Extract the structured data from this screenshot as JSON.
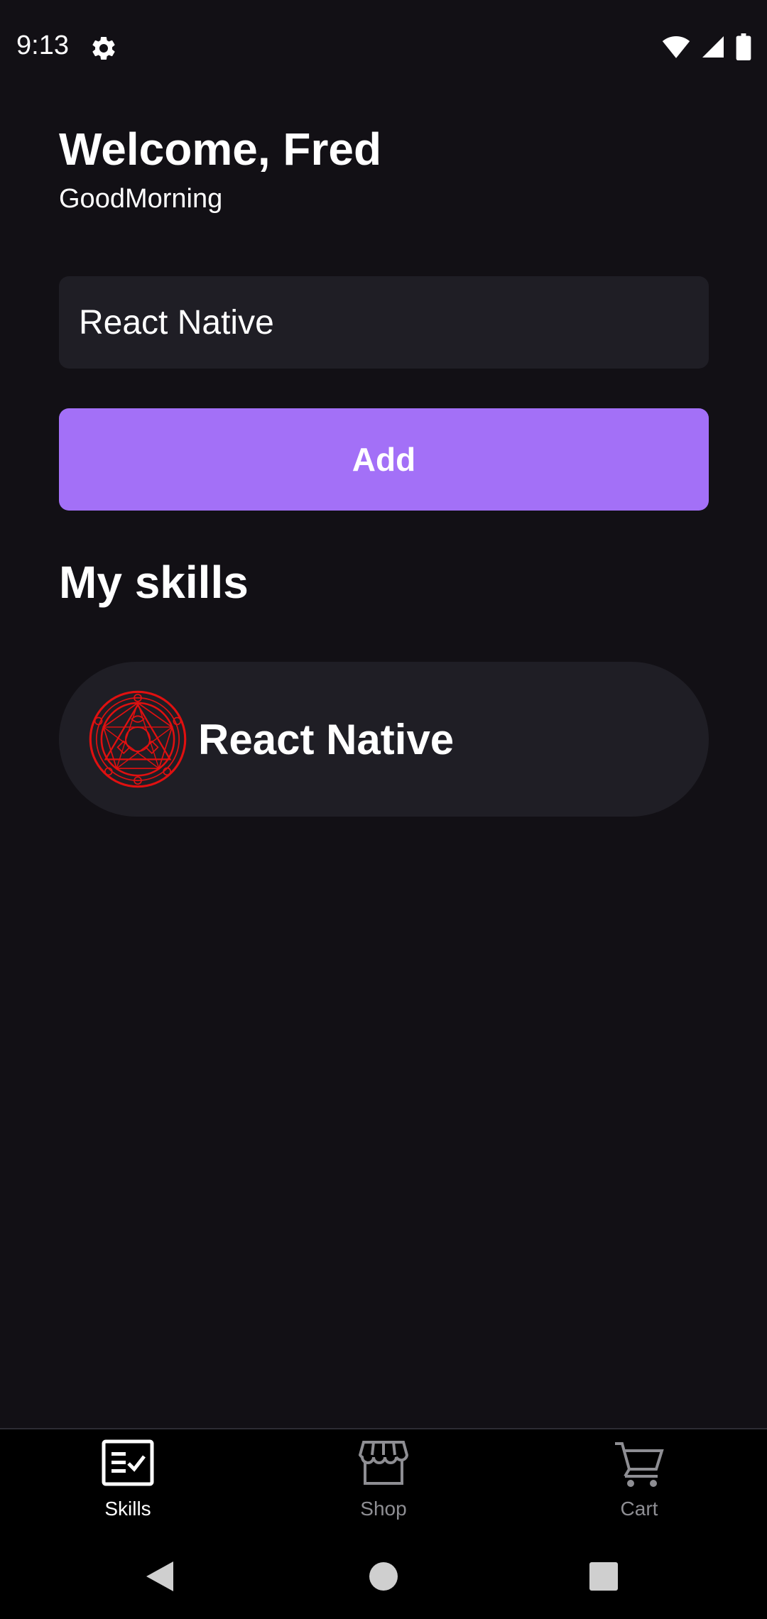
{
  "status_bar": {
    "time": "9:13",
    "icons": [
      "gear-icon",
      "wifi-icon",
      "signal-icon",
      "battery-icon"
    ]
  },
  "header": {
    "title": "Welcome, Fred",
    "subtitle": "GoodMorning"
  },
  "form": {
    "input_value": "React Native",
    "add_label": "Add"
  },
  "skills_section": {
    "title": "My skills",
    "items": [
      {
        "name": "React Native",
        "icon": "transmutation-circle-icon"
      }
    ]
  },
  "tab_bar": {
    "tabs": [
      {
        "label": "Skills",
        "icon": "checklist-icon",
        "active": true
      },
      {
        "label": "Shop",
        "icon": "storefront-icon",
        "active": false
      },
      {
        "label": "Cart",
        "icon": "cart-icon",
        "active": false
      }
    ]
  },
  "nav_bar": {
    "buttons": [
      "back-icon",
      "home-icon",
      "recents-icon"
    ]
  },
  "colors": {
    "background": "#121015",
    "surface": "#1f1e25",
    "accent": "#a370f7",
    "emblem": "#e01010",
    "inactive_tab": "#8e8e93"
  }
}
